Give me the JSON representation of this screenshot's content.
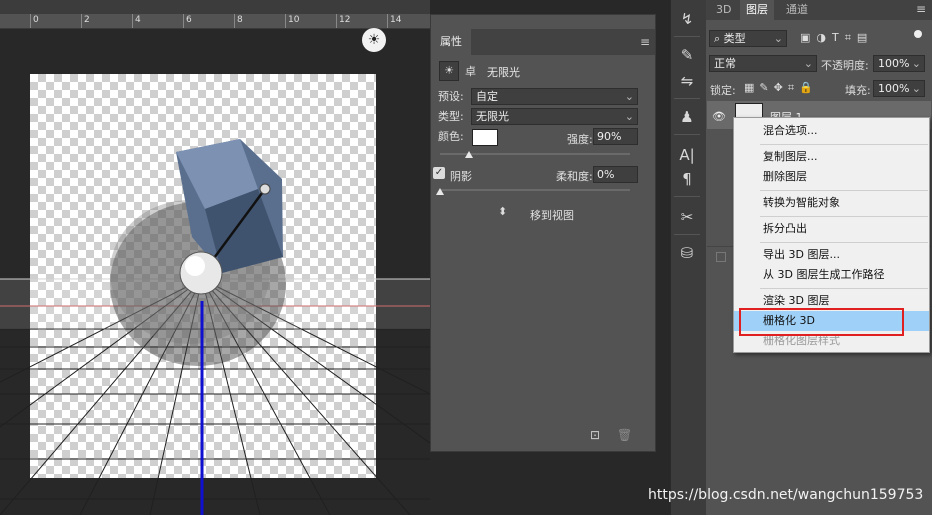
{
  "ruler": {
    "ticks": [
      "0",
      "2",
      "4",
      "6",
      "8",
      "10",
      "12",
      "14"
    ]
  },
  "properties": {
    "tab": "属性",
    "light_name": "无限光",
    "preset_label": "预设:",
    "preset_value": "自定",
    "type_label": "类型:",
    "type_value": "无限光",
    "color_label": "颜色:",
    "color_value": "#ffffff",
    "intensity_label": "强度:",
    "intensity_value": "90%",
    "intensity_level": 0.15,
    "shadow_label": "阴影",
    "softness_label": "柔和度:",
    "softness_value": "0%",
    "softness_level": 0.0,
    "move_to_view": "移到视图"
  },
  "layers_panel": {
    "tabs": [
      "3D",
      "图层",
      "通道"
    ],
    "active_tab": "图层",
    "filter_value": "类型",
    "blend_mode": "正常",
    "opacity_label": "不透明度:",
    "opacity_value": "100%",
    "lock_label": "锁定:",
    "fill_label": "填充:",
    "fill_value": "100%",
    "layer_name": "图层 1"
  },
  "context_menu": {
    "items": [
      {
        "label": "混合选项...",
        "state": "normal"
      },
      {
        "label": "复制图层...",
        "state": "normal"
      },
      {
        "label": "删除图层",
        "state": "normal"
      },
      {
        "label": "转换为智能对象",
        "state": "normal"
      },
      {
        "label": "拆分凸出",
        "state": "normal"
      },
      {
        "label": "导出 3D 图层...",
        "state": "normal"
      },
      {
        "label": "从 3D 图层生成工作路径",
        "state": "normal"
      },
      {
        "label": "渲染 3D 图层",
        "state": "normal"
      },
      {
        "label": "栅格化 3D",
        "state": "highlighted"
      },
      {
        "label": "栅格化图层样式",
        "state": "disabled"
      }
    ]
  },
  "watermark": "https://blog.csdn.net/wangchun159753",
  "colors": {
    "panel": "#535353",
    "dark": "#282828",
    "highlight": "#9fd0f8",
    "callout": "#e02020"
  }
}
